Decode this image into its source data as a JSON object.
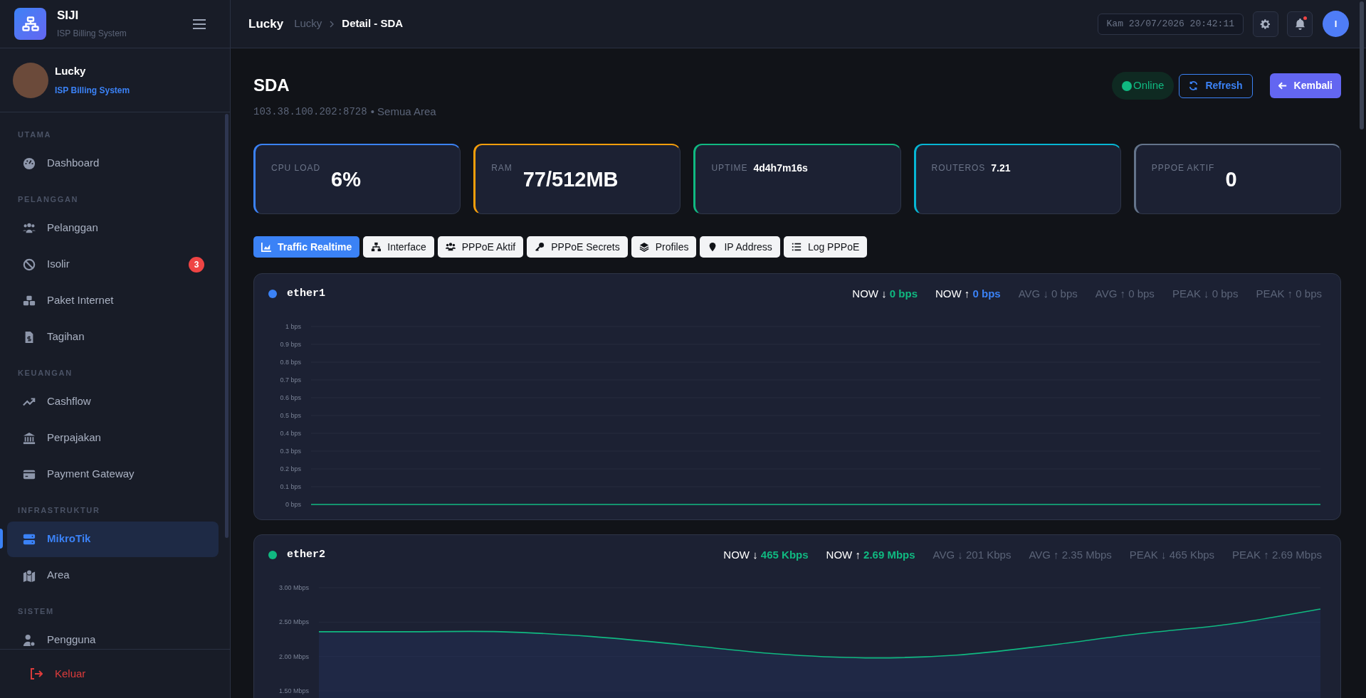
{
  "sidebar": {
    "brand": {
      "title": "SIJI",
      "subtitle": "ISP Billing System"
    },
    "profile": {
      "name": "Lucky",
      "role": "ISP Billing System"
    },
    "sections": [
      {
        "label": "UTAMA",
        "items": [
          {
            "label": "Dashboard",
            "selected": false
          }
        ]
      },
      {
        "label": "PELANGGAN",
        "items": [
          {
            "label": "Pelanggan",
            "selected": false
          },
          {
            "label": "Isolir",
            "selected": false,
            "badge": "3"
          },
          {
            "label": "Paket Internet",
            "selected": false
          },
          {
            "label": "Tagihan",
            "selected": false
          }
        ]
      },
      {
        "label": "KEUANGAN",
        "items": [
          {
            "label": "Cashflow",
            "selected": false
          },
          {
            "label": "Perpajakan",
            "selected": false
          },
          {
            "label": "Payment Gateway",
            "selected": false
          }
        ]
      },
      {
        "label": "INFRASTRUKTUR",
        "items": [
          {
            "label": "MikroTik",
            "selected": true
          },
          {
            "label": "Area",
            "selected": false
          }
        ]
      },
      {
        "label": "SISTEM",
        "items": [
          {
            "label": "Pengguna",
            "selected": false
          }
        ]
      }
    ],
    "logout": "Keluar"
  },
  "header": {
    "title": "Lucky",
    "breadcrumb": [
      "Lucky",
      "Detail - SDA"
    ],
    "datetime": "Kam 23/07/2026 20:42:11",
    "notification_unread": true,
    "avatar": "I"
  },
  "page": {
    "title": "SDA",
    "address": "103.38.100.202:8728",
    "area": "• Semua Area",
    "status": "Online",
    "buttons": [
      "Refresh",
      "Kembali"
    ]
  },
  "cards": [
    {
      "label": "CPU LOAD",
      "value": "6%",
      "kind": "big",
      "color": "#3b82f6"
    },
    {
      "label": "RAM",
      "value": "77/512MB",
      "kind": "big",
      "color": "#f59e0b"
    },
    {
      "label": "UPTIME",
      "value": "4d4h7m16s",
      "kind": "compact",
      "color": "#10b981"
    },
    {
      "label": "ROUTEROS",
      "value": "7.21",
      "kind": "compact",
      "color": "#06b6d4"
    },
    {
      "label": "PPPOE AKTIF",
      "value": "0",
      "kind": "big",
      "color": "#64748b"
    }
  ],
  "tabs": [
    {
      "label": "Traffic Realtime",
      "selected": true
    },
    {
      "label": "Interface",
      "selected": false
    },
    {
      "label": "PPPoE Aktif",
      "selected": false
    },
    {
      "label": "PPPoE Secrets",
      "selected": false
    },
    {
      "label": "Profiles",
      "selected": false
    },
    {
      "label": "IP Address",
      "selected": false
    },
    {
      "label": "Log PPPoE",
      "selected": false
    }
  ],
  "interfaces": [
    {
      "name": "ether1",
      "color": "#3b82f6",
      "stats": [
        {
          "kind": "now",
          "label": "NOW ↓",
          "value": "0 bps",
          "color": "#10b981"
        },
        {
          "kind": "now",
          "label": "NOW ↑",
          "value": "0 bps",
          "color": "#3b82f6"
        },
        {
          "kind": "summary",
          "text": "AVG ↓ 0 bps"
        },
        {
          "kind": "summary",
          "text": "AVG ↑ 0 bps"
        },
        {
          "kind": "summary",
          "text": "PEAK ↓ 0 bps"
        },
        {
          "kind": "summary",
          "text": "PEAK ↑ 0 bps"
        }
      ],
      "chart_data": {
        "type": "line",
        "ylim": [
          0,
          1
        ],
        "yticks": [
          {
            "value": 0,
            "label": "0 bps"
          },
          {
            "value": 0.1,
            "label": "0.1 bps"
          },
          {
            "value": 0.2,
            "label": "0.2 bps"
          },
          {
            "value": 0.3,
            "label": "0.3 bps"
          },
          {
            "value": 0.4,
            "label": "0.4 bps"
          },
          {
            "value": 0.5,
            "label": "0.5 bps"
          },
          {
            "value": 0.6,
            "label": "0.6 bps"
          },
          {
            "value": 0.7,
            "label": "0.7 bps"
          },
          {
            "value": 0.8,
            "label": "0.8 bps"
          },
          {
            "value": 0.9,
            "label": "0.9 bps"
          },
          {
            "value": 1,
            "label": "1 bps"
          }
        ],
        "series": [
          {
            "color": "#10b981",
            "values": [
              0,
              0,
              0,
              0,
              0,
              0,
              0,
              0,
              0,
              0,
              0,
              0
            ]
          }
        ]
      }
    },
    {
      "name": "ether2",
      "color": "#10b981",
      "stats": [
        {
          "kind": "now",
          "label": "NOW ↓",
          "value": "465 Kbps",
          "color": "#10b981"
        },
        {
          "kind": "now",
          "label": "NOW ↑",
          "value": "2.69 Mbps",
          "color": "#10b981"
        },
        {
          "kind": "summary",
          "text": "AVG ↓ 201 Kbps"
        },
        {
          "kind": "summary",
          "text": "AVG ↑ 2.35 Mbps"
        },
        {
          "kind": "summary",
          "text": "PEAK ↓ 465 Kbps"
        },
        {
          "kind": "summary",
          "text": "PEAK ↑ 2.69 Mbps"
        }
      ],
      "chart_data": {
        "type": "area",
        "ylim": [
          1.5,
          3
        ],
        "yticks": [
          {
            "value": 1.5,
            "label": "1.50 Mbps"
          },
          {
            "value": 2,
            "label": "2.00 Mbps"
          },
          {
            "value": 2.5,
            "label": "2.50 Mbps"
          },
          {
            "value": 3,
            "label": "3.00 Mbps"
          }
        ],
        "series": [
          {
            "color": "#10b981",
            "values": [
              2.36,
              2.36,
              2.36,
              2.29,
              2.17,
              2.04,
              1.98,
              2.02,
              2.16,
              2.33,
              2.47,
              2.69
            ]
          }
        ]
      }
    }
  ]
}
